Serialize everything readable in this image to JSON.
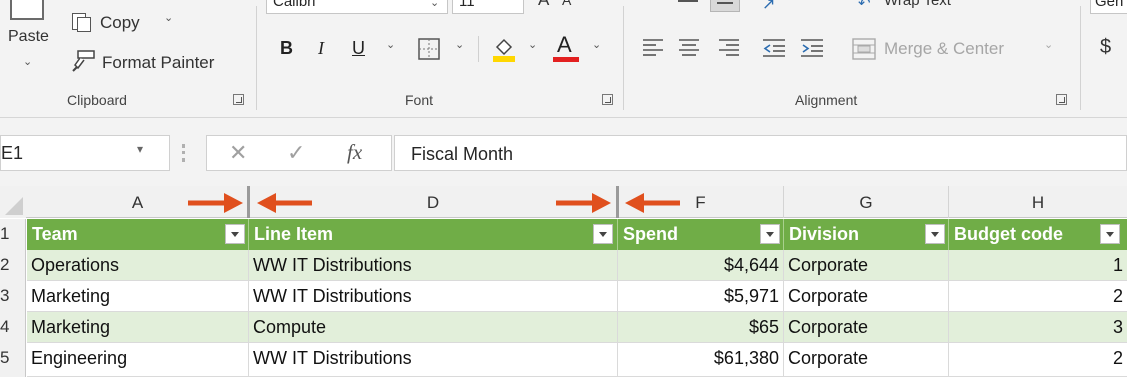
{
  "ribbon": {
    "clipboard": {
      "paste_label": "Paste",
      "copy_label": "Copy",
      "format_painter_label": "Format Painter",
      "group_label": "Clipboard"
    },
    "font": {
      "font_name": "Calibri",
      "font_size": "11",
      "bold": "B",
      "italic": "I",
      "underline": "U",
      "font_color_glyph": "A",
      "group_label": "Font"
    },
    "alignment": {
      "wrap_text_label": "Wrap Text",
      "merge_center_label": "Merge & Center",
      "group_label": "Alignment"
    },
    "number": {
      "format_value": "Gen",
      "currency_symbol": "$"
    }
  },
  "formula_bar": {
    "name_box": "E1",
    "fx": "fx",
    "content": "Fiscal Month"
  },
  "grid": {
    "columns": [
      "A",
      "D",
      "F",
      "G",
      "H"
    ],
    "row_numbers": [
      "1",
      "2",
      "3",
      "4",
      "5"
    ],
    "headers": [
      "Team",
      "Line Item",
      "Spend",
      "Division",
      "Budget code"
    ],
    "rows": [
      [
        "Operations",
        "WW IT Distributions",
        "$4,644",
        "Corporate",
        "1"
      ],
      [
        "Marketing",
        "WW IT Distributions",
        "$5,971",
        "Corporate",
        "2"
      ],
      [
        "Marketing",
        "Compute",
        "$65",
        "Corporate",
        "3"
      ],
      [
        "Engineering",
        "WW IT Distributions",
        "$61,380",
        "Corporate",
        "2"
      ]
    ]
  },
  "colors": {
    "header_green": "#70ad47",
    "band_green": "#e2efda",
    "arrow_orange": "#e0501e",
    "highlight_yellow": "#ffd700",
    "font_red": "#e32020"
  }
}
